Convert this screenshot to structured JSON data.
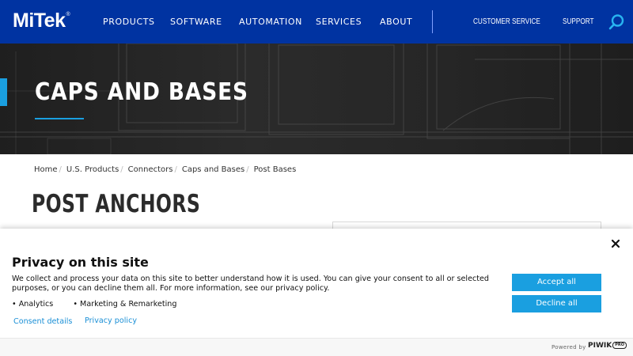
{
  "brand": {
    "name": "MiTek",
    "trademark": "®"
  },
  "nav": {
    "items": [
      "PRODUCTS",
      "SOFTWARE",
      "AUTOMATION",
      "SERVICES",
      "ABOUT"
    ],
    "utility": [
      "CUSTOMER SERVICE",
      "SUPPORT"
    ],
    "search_icon": "search-icon"
  },
  "hero": {
    "title": "CAPS AND BASES"
  },
  "breadcrumb": [
    "Home",
    "U.S. Products",
    "Connectors",
    "Caps and Bases",
    "Post Bases"
  ],
  "breadcrumb_separator": "/",
  "page_title": "POST ANCHORS",
  "privacy": {
    "title": "Privacy on this site",
    "text": "We collect and process your data on this site to better understand how it is used. You can give your consent to all or selected purposes, or you can decline them all. For more information, see our privacy policy.",
    "purposes": [
      "• Analytics",
      "• Marketing & Remarketing"
    ],
    "consent_details": "Consent details",
    "privacy_policy": "Privacy policy",
    "accept_all": "Accept all",
    "decline_all": "Decline all",
    "powered_by": "Powered by",
    "vendor": "PIWIK",
    "vendor_badge": "PRO"
  },
  "colors": {
    "nav_bg": "#0033a1",
    "accent": "#1a9fe0",
    "link": "#1a8fd6"
  }
}
